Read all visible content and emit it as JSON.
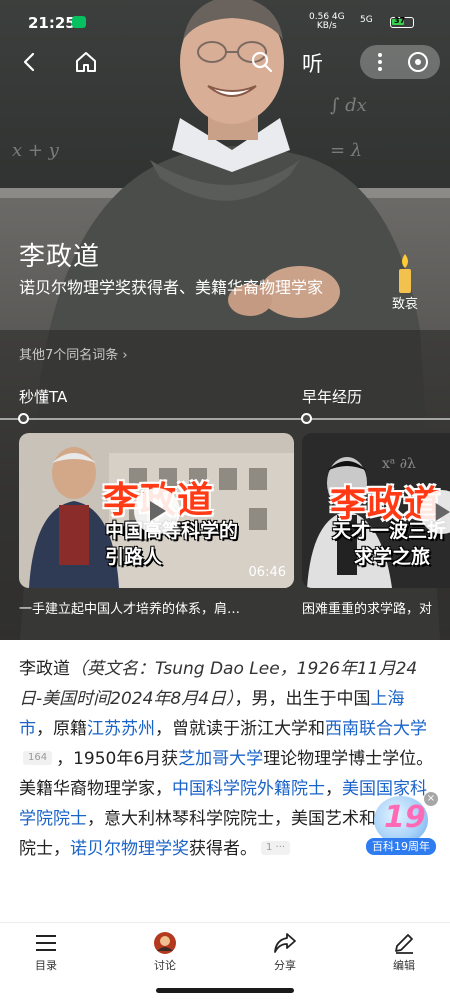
{
  "status_bar": {
    "time": "21:25",
    "network_speed": "0.56",
    "network_unit": "KB/s",
    "signal_4g": "4G",
    "signal_5g": "5G",
    "battery": "37"
  },
  "top_nav": {
    "listen_label": "听"
  },
  "entry": {
    "title": "李政道",
    "subtitle": "诺贝尔物理学奖获得者、美籍华裔物理学家",
    "condolence_label": "致哀",
    "namesakes_link": "其他7个同名词条 ›"
  },
  "sections": {
    "left_label": "秒懂TA",
    "right_label": "早年经历"
  },
  "cards": [
    {
      "title_text": "李政道",
      "subtitle_line1": "中国高等科学的",
      "subtitle_line2": "引路人",
      "duration": "06:46",
      "caption": "一手建立起中国人才培养的体系，肩…"
    },
    {
      "title_text": "李政道",
      "subtitle_line1": "天才一波三折",
      "subtitle_line2": "求学之旅",
      "caption": "困难重重的求学路，对"
    }
  ],
  "article": {
    "p1": "李政道",
    "english_name": "（英文名：Tsung Dao Lee，1926年11月24日-美国时间2024年8月4日）",
    "p2": "，男，出生于中国",
    "link_shanghai": "上海市",
    "p3": "，原籍",
    "link_jiangsu": "江苏苏州",
    "p4": "，曾就读于浙江大学和",
    "link_swau": "西南联合大学",
    "ref1": "164",
    "p5": "，1950年6月获",
    "link_chicago": "芝加哥大学",
    "p6": "理论物理学博士学位。美籍华裔物理学家，",
    "link_cas": "中国科学院外籍院士",
    "p7": "，",
    "link_nas": "美国国家科学院院士",
    "p8": "，意大利林琴科学院院士，美国艺术和科学院院士，",
    "link_nobel": "诺贝尔物理学奖",
    "p9": "获得者。",
    "ref2": "1 ···"
  },
  "anniversary_badge": {
    "number": "19",
    "label": "百科19周年"
  },
  "bottom_bar": {
    "tabs": [
      {
        "label": "目录"
      },
      {
        "label": "讨论"
      },
      {
        "label": "分享"
      },
      {
        "label": "编辑"
      }
    ]
  },
  "colors": {
    "link": "#1a63c8",
    "card_title": "#ff3a14",
    "badge_blue": "#2f7cf0"
  }
}
